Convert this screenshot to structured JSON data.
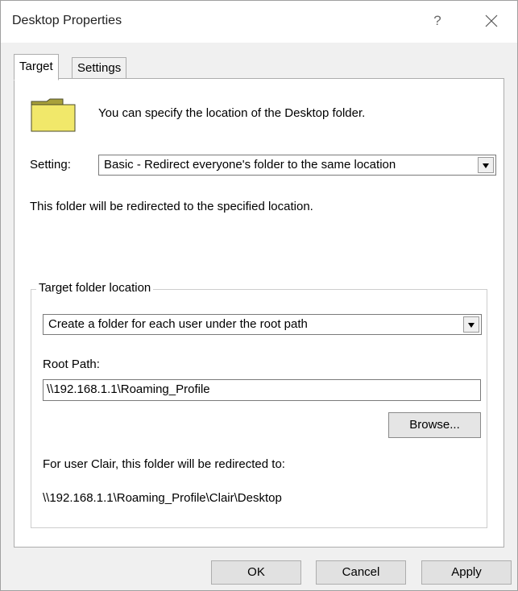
{
  "window": {
    "title": "Desktop Properties",
    "help_label": "?"
  },
  "tabs": [
    {
      "label": "Target",
      "active": true
    },
    {
      "label": "Settings",
      "active": false
    }
  ],
  "target": {
    "intro_text": "You can specify the location of the Desktop folder.",
    "setting_label": "Setting:",
    "setting_value": "Basic - Redirect everyone's folder to the same location",
    "redirect_note": "This folder will be redirected to the specified location.",
    "group_title": "Target folder location",
    "location_option": "Create a folder for each user under the root path",
    "root_path_label": "Root Path:",
    "root_path_value": "\\\\192.168.1.1\\Roaming_Profile",
    "browse_label": "Browse...",
    "preview_label": "For user Clair, this folder will be redirected to:",
    "preview_path": "\\\\192.168.1.1\\Roaming_Profile\\Clair\\Desktop"
  },
  "footer": {
    "ok_label": "OK",
    "cancel_label": "Cancel",
    "apply_label": "Apply"
  },
  "icons": {
    "folder": "folder-icon",
    "close": "close-icon",
    "dropdown": "chevron-down-icon"
  },
  "colors": {
    "folder_fill": "#f1e86a",
    "window_bg": "#f0f0f0",
    "panel_bg": "#ffffff"
  }
}
